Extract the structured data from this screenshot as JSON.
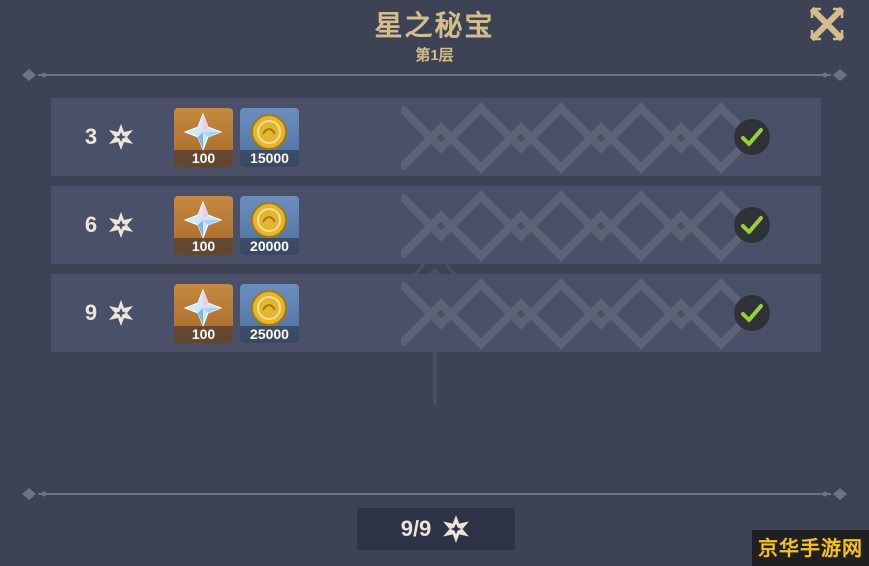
{
  "header": {
    "title": "星之秘宝",
    "subtitle": "第1层"
  },
  "rewards": [
    {
      "required_stars": "3",
      "items": [
        {
          "icon": "primogem-icon",
          "count": "100"
        },
        {
          "icon": "mora-coin-icon",
          "count": "15000"
        }
      ],
      "claimed": true
    },
    {
      "required_stars": "6",
      "items": [
        {
          "icon": "primogem-icon",
          "count": "100"
        },
        {
          "icon": "mora-coin-icon",
          "count": "20000"
        }
      ],
      "claimed": true
    },
    {
      "required_stars": "9",
      "items": [
        {
          "icon": "primogem-icon",
          "count": "100"
        },
        {
          "icon": "mora-coin-icon",
          "count": "25000"
        }
      ],
      "claimed": true
    }
  ],
  "progress": {
    "text": "9/9"
  },
  "watermark": {
    "text": "京华手游网"
  },
  "colors": {
    "background": "#3d4255",
    "row": "#4a5067",
    "title_gold": "#d3bc8e",
    "check_green": "#9ad032",
    "item_gold": "#b97a37",
    "item_blue": "#5a7fae"
  }
}
